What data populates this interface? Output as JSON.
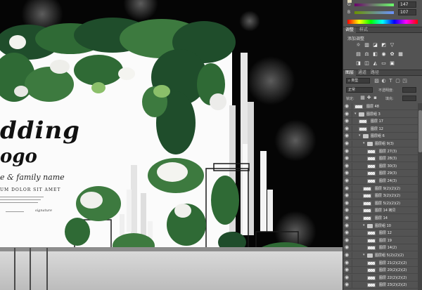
{
  "canvas": {
    "title_line1": "dding",
    "title_line2": "ogo",
    "names_line": "e & family name",
    "heading_small": "UM DOLOR SIT AMET",
    "signature_label": "signature"
  },
  "color_panel": {
    "slider_g_label": "G",
    "slider_g_value": "147",
    "slider_b_label": "B",
    "slider_b_value": "107"
  },
  "adjustments": {
    "tabs": [
      "调整",
      "样式"
    ],
    "subtitle": "添加调整",
    "icon_row_1": [
      "brightness-icon",
      "levels-icon",
      "curves-icon",
      "exposure-icon"
    ],
    "icon_row_2": [
      "vibrance-icon",
      "hue-icon",
      "color-balance-icon",
      "bw-icon",
      "photo-filter-icon",
      "channel-mixer-icon"
    ],
    "icon_row_3": [
      "invert-icon",
      "posterize-icon",
      "threshold-icon",
      "gradient-map-icon",
      "selective-color-icon"
    ]
  },
  "layers_panel": {
    "tabs": [
      "图层",
      "通道",
      "路径"
    ],
    "filter_label": "类型",
    "blend_mode": "正常",
    "opacity_label": "不透明度:",
    "lock_label": "锁定:",
    "fill_label": "填充:",
    "layers": [
      {
        "name": "图层 48",
        "kind": "layer",
        "indent": 0
      },
      {
        "name": "图层组 3",
        "kind": "group",
        "indent": 0
      },
      {
        "name": "图层 17",
        "kind": "layer",
        "indent": 1
      },
      {
        "name": "图层 12",
        "kind": "layer",
        "indent": 1
      },
      {
        "name": "图层组 6",
        "kind": "group",
        "indent": 1
      },
      {
        "name": "图层组 9(3)",
        "kind": "group",
        "indent": 2
      },
      {
        "name": "图层 27(3)",
        "kind": "layer",
        "indent": 3
      },
      {
        "name": "图层 28(3)",
        "kind": "layer",
        "indent": 3
      },
      {
        "name": "图层 30(3)",
        "kind": "layer",
        "indent": 3
      },
      {
        "name": "图层 29(3)",
        "kind": "layer",
        "indent": 3
      },
      {
        "name": "图层 24(3)",
        "kind": "layer",
        "indent": 3
      },
      {
        "name": "图层 9(2)(2)(2)",
        "kind": "layer",
        "indent": 2
      },
      {
        "name": "图层 3(2)(2)(2)",
        "kind": "layer",
        "indent": 2
      },
      {
        "name": "图层 5(2)(2)(2)",
        "kind": "layer",
        "indent": 2
      },
      {
        "name": "图层 14 拷贝",
        "kind": "layer",
        "indent": 2
      },
      {
        "name": "图层 14",
        "kind": "layer",
        "indent": 2
      },
      {
        "name": "图层组 10",
        "kind": "group",
        "indent": 2
      },
      {
        "name": "图层 12",
        "kind": "layer",
        "indent": 3
      },
      {
        "name": "图层 19",
        "kind": "layer",
        "indent": 3
      },
      {
        "name": "图层 14(2)",
        "kind": "layer",
        "indent": 3
      },
      {
        "name": "图层组 5(2)(2)(2)",
        "kind": "group",
        "indent": 2
      },
      {
        "name": "图层 21(2)(2)(2)",
        "kind": "layer",
        "indent": 3
      },
      {
        "name": "图层 20(2)(2)(2)",
        "kind": "layer",
        "indent": 3
      },
      {
        "name": "图层 22(2)(2)(2)",
        "kind": "layer",
        "indent": 3
      },
      {
        "name": "图层 23(2)(2)(2)",
        "kind": "layer",
        "indent": 3
      }
    ]
  },
  "colors": {
    "panel_bg": "#535353",
    "canvas_bg": "#050505",
    "foliage_dark": "#1f4d2b",
    "foliage_mid": "#3d7a3f",
    "foliage_light": "#8bbf6a"
  }
}
